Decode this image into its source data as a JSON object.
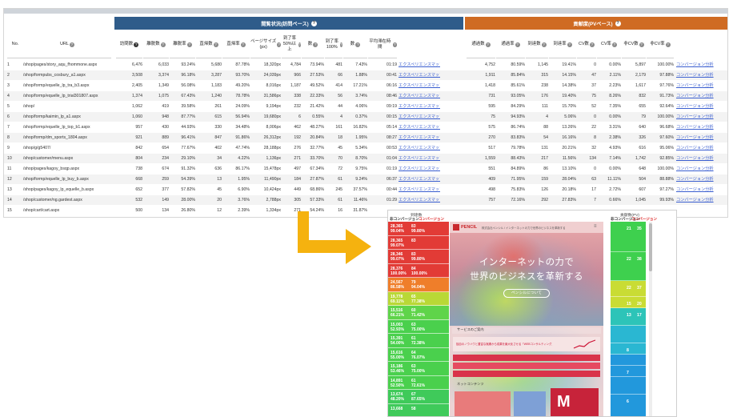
{
  "table": {
    "group_left": "閲覧状況(訪問ベース)",
    "group_right": "貢献度(PVベース)",
    "headers": [
      "No.",
      "URL",
      "訪問数",
      "離脱数",
      "離脱率",
      "直帰数",
      "直帰率",
      "ページサイズ(px)",
      "到了率50%以上",
      "数",
      "到了率100%",
      "数",
      "平均滞在時間",
      "",
      "通過数",
      "通過率",
      "到達数",
      "到達率",
      "CV数",
      "CV率",
      "非CV数",
      "非CV率",
      ""
    ],
    "rows": [
      [
        "1",
        "/shop/pages/story_aqu_fhommone.aspx",
        "6,476",
        "6,033",
        "93.24%",
        "5,680",
        "87.78%",
        "18,320px",
        "4,784",
        "73.94%",
        "481",
        "7.43%",
        "01:19",
        "エクスペリエンスマップ",
        "4,752",
        "80.59%",
        "1,145",
        "19.41%",
        "0",
        "0.00%",
        "5,897",
        "100.00%",
        "コンバージョン分析"
      ],
      [
        "2",
        "/shop/formpubs_cosbury_a1.aspx",
        "3,508",
        "3,374",
        "96.18%",
        "3,287",
        "93.70%",
        "24,039px",
        "966",
        "27.53%",
        "66",
        "1.88%",
        "00:41",
        "エクスペリエンスマップ",
        "1,911",
        "85.84%",
        "315",
        "14.15%",
        "47",
        "2.11%",
        "2,179",
        "97.88%",
        "コンバージョン分析"
      ],
      [
        "3",
        "/shop/formp/equelle_lp_tra_b3.aspx",
        "2,405",
        "1,349",
        "56.08%",
        "1,183",
        "49.20%",
        "8,016px",
        "1,187",
        "49.52%",
        "414",
        "17.21%",
        "06:16",
        "エクスペリエンスマップ",
        "1,418",
        "85.61%",
        "238",
        "14.38%",
        "37",
        "2.23%",
        "1,617",
        "97.76%",
        "コンバージョン分析"
      ],
      [
        "4",
        "/shop/formp/equelle_lp_trial301807.aspx",
        "1,374",
        "1,075",
        "67.43%",
        "1,240",
        "78.78%",
        "31,586px",
        "338",
        "22.33%",
        "56",
        "3.74%",
        "08:46",
        "エクスペリエンスマップ",
        "731",
        "93.05%",
        "176",
        "19.40%",
        "75",
        "8.26%",
        "832",
        "91.73%",
        "コンバージョン分析"
      ],
      [
        "5",
        "/shop/",
        "1,062",
        "419",
        "39.58%",
        "261",
        "24.09%",
        "9,194px",
        "232",
        "21.42%",
        "44",
        "4.06%",
        "09:19",
        "エクスペリエンスマップ",
        "595",
        "84.29%",
        "111",
        "15.70%",
        "52",
        "7.35%",
        "655",
        "92.64%",
        "コンバージョン分析"
      ],
      [
        "6",
        "/shop/formp/kaimin_lp_a1.aspx",
        "1,060",
        "948",
        "87.77%",
        "615",
        "56.94%",
        "19,680px",
        "6",
        "0.55%",
        "4",
        "0.37%",
        "00:15",
        "エクスペリエンスマップ",
        "75",
        "94.93%",
        "4",
        "5.06%",
        "0",
        "0.00%",
        "79",
        "100.00%",
        "コンバージョン分析"
      ],
      [
        "7",
        "/shop/formp/equelle_lp_top_b1.aspx",
        "957",
        "430",
        "44.93%",
        "330",
        "34.48%",
        "8,006px",
        "462",
        "48.27%",
        "161",
        "16.82%",
        "05:14",
        "エクスペリエンスマップ",
        "575",
        "86.74%",
        "88",
        "13.26%",
        "22",
        "3.31%",
        "640",
        "96.68%",
        "コンバージョン分析"
      ],
      [
        "8",
        "/shop/formp/dm_sports_1804.aspx",
        "921",
        "889",
        "96.41%",
        "847",
        "91.86%",
        "26,312px",
        "192",
        "20.84%",
        "18",
        "1.95%",
        "08:27",
        "エクスペリエンスマップ",
        "270",
        "83.83%",
        "54",
        "16.16%",
        "8",
        "2.38%",
        "326",
        "97.60%",
        "コンバージョン分析"
      ],
      [
        "9",
        "/shop/g/g5407/",
        "842",
        "654",
        "77.67%",
        "402",
        "47.74%",
        "28,188px",
        "276",
        "32.77%",
        "45",
        "5.34%",
        "00:53",
        "エクスペリエンスマップ",
        "517",
        "79.78%",
        "131",
        "20.21%",
        "32",
        "4.93%",
        "616",
        "95.06%",
        "コンバージョン分析"
      ],
      [
        "10",
        "/shop/customer/menu.aspx",
        "804",
        "234",
        "29.10%",
        "34",
        "4.22%",
        "1,136px",
        "271",
        "33.70%",
        "70",
        "8.70%",
        "01:04",
        "エクスペリエンスマップ",
        "1,559",
        "88.43%",
        "217",
        "11.56%",
        "134",
        "7.14%",
        "1,742",
        "92.85%",
        "コンバージョン分析"
      ],
      [
        "11",
        "/shop/pages/kagoy_bsqp.aspx",
        "738",
        "674",
        "91.32%",
        "636",
        "86.17%",
        "15,478px",
        "497",
        "67.34%",
        "72",
        "9.75%",
        "01:19",
        "エクスペリエンスマップ",
        "551",
        "84.89%",
        "86",
        "13.10%",
        "0",
        "0.00%",
        "648",
        "100.00%",
        "コンバージョン分析"
      ],
      [
        "12",
        "/shop/formp/equelle_lp_buy_b.aspx",
        "668",
        "259",
        "54.39%",
        "13",
        "1.95%",
        "11,490px",
        "184",
        "27.87%",
        "61",
        "9.24%",
        "06:37",
        "エクスペリエンスマップ",
        "409",
        "71.95%",
        "159",
        "28.04%",
        "63",
        "11.11%",
        "504",
        "88.88%",
        "コンバージョン分析"
      ],
      [
        "13",
        "/shop/pages/kagoy_lp_equelle_b.aspx",
        "652",
        "377",
        "57.82%",
        "45",
        "6.90%",
        "10,424px",
        "449",
        "68.86%",
        "245",
        "37.57%",
        "00:44",
        "エクスペリエンスマップ",
        "498",
        "75.83%",
        "126",
        "20.18%",
        "17",
        "2.72%",
        "607",
        "97.27%",
        "コンバージョン分析"
      ],
      [
        "14",
        "/shop/customer/ng.gardest.aspx",
        "532",
        "149",
        "28.00%",
        "20",
        "3.76%",
        "2,788px",
        "305",
        "57.33%",
        "61",
        "11.46%",
        "01:29",
        "エクスペリエンスマップ",
        "757",
        "72.16%",
        "292",
        "27.83%",
        "7",
        "0.66%",
        "1,045",
        "99.93%",
        "コンバージョン分析"
      ],
      [
        "15",
        "/shop/cart/cart.aspx",
        "500",
        "134",
        "26.80%",
        "12",
        "2.39%",
        "1,334px",
        "271",
        "54.24%",
        "16",
        "31.87%",
        "",
        "",
        "",
        "",
        "",
        "",
        "",
        "",
        "",
        "",
        ""
      ]
    ]
  },
  "panel": {
    "left_caption": "到達数",
    "right_caption": "貢献数(PV)",
    "label_noncv": "非コンバージョン",
    "label_cv": "コンバージョン",
    "left_blocks": [
      {
        "a": "28,365",
        "b": "83",
        "c": "99.04%",
        "d": "99.80%",
        "color": "#e23b36"
      },
      {
        "a": "28,365",
        "b": "83",
        "c": "99.07%",
        "d": "",
        "color": "#e23b36"
      },
      {
        "a": "28,346",
        "b": "83",
        "c": "99.07%",
        "d": "99.80%",
        "color": "#e23b36"
      },
      {
        "a": "28,376",
        "b": "84",
        "c": "100.00%",
        "d": "100.00%",
        "color": "#e23b36"
      },
      {
        "a": "24,567",
        "b": "79",
        "c": "86.58%",
        "d": "94.04%",
        "color": "#ef7e2a"
      },
      {
        "a": "19,778",
        "b": "65",
        "c": "69.11%",
        "d": "77.38%",
        "color": "#b9d836"
      },
      {
        "a": "15,516",
        "b": "60",
        "c": "66.21%",
        "d": "71.42%",
        "color": "#5fd44a"
      },
      {
        "a": "15,003",
        "b": "63",
        "c": "52.93%",
        "d": "75.00%",
        "color": "#4ad04d"
      },
      {
        "a": "15,391",
        "b": "61",
        "c": "54.00%",
        "d": "72.38%",
        "color": "#4ad04d"
      },
      {
        "a": "15,616",
        "b": "64",
        "c": "55.00%",
        "d": "76.07%",
        "color": "#4ad04d"
      },
      {
        "a": "15,186",
        "b": "63",
        "c": "53.46%",
        "d": "75.00%",
        "color": "#4ad04d"
      },
      {
        "a": "14,891",
        "b": "61",
        "c": "52.50%",
        "d": "72.61%",
        "color": "#4ad04d"
      },
      {
        "a": "13,674",
        "b": "67",
        "c": "48.20%",
        "d": "87.65%",
        "color": "#3fca5a"
      },
      {
        "a": "13,668",
        "b": "58",
        "c": "",
        "d": "",
        "color": "#3fca5a"
      }
    ],
    "right_blocks": [
      {
        "a": "21",
        "b": "35",
        "color": "#3ed04e"
      },
      {
        "a": "22",
        "b": "38",
        "color": "#3ed04e"
      },
      {
        "a": "22",
        "b": "37",
        "color": "#c9dc34"
      },
      {
        "a": "15",
        "b": "20",
        "color": "#c9dc34"
      },
      {
        "a": "13",
        "b": "17",
        "color": "#2dc4b8"
      },
      {
        "a": "",
        "b": "",
        "color": "#2ab7d2"
      },
      {
        "a": "8",
        "b": "",
        "color": "#2ab7d2"
      },
      {
        "a": "",
        "b": "",
        "color": "#2298dc"
      },
      {
        "a": "7",
        "b": "",
        "color": "#2298dc"
      },
      {
        "a": "",
        "b": "",
        "color": "#2298dc"
      },
      {
        "a": "6",
        "b": "",
        "color": "#2298dc"
      }
    ],
    "page": {
      "logo": "PENCIL",
      "tagline": "株式会社ペンシル / インターネットの力で世界のビジネスを革新する",
      "hero_line1": "インターネットの力で",
      "hero_line2": "世界のビジネスを革新する",
      "hero_button": "ペンシルについて",
      "section1": "サービスのご案内",
      "service_text": "独自のノウハウと豊富な実績から成果を最大化させる「WEBコンサルティング」",
      "section2": "ネットコンテンツ"
    }
  },
  "colors": {
    "group_left": "#2f5c8a",
    "group_right": "#cf6b23",
    "arrow": "#f5b20f",
    "link": "#3b5fd0"
  }
}
